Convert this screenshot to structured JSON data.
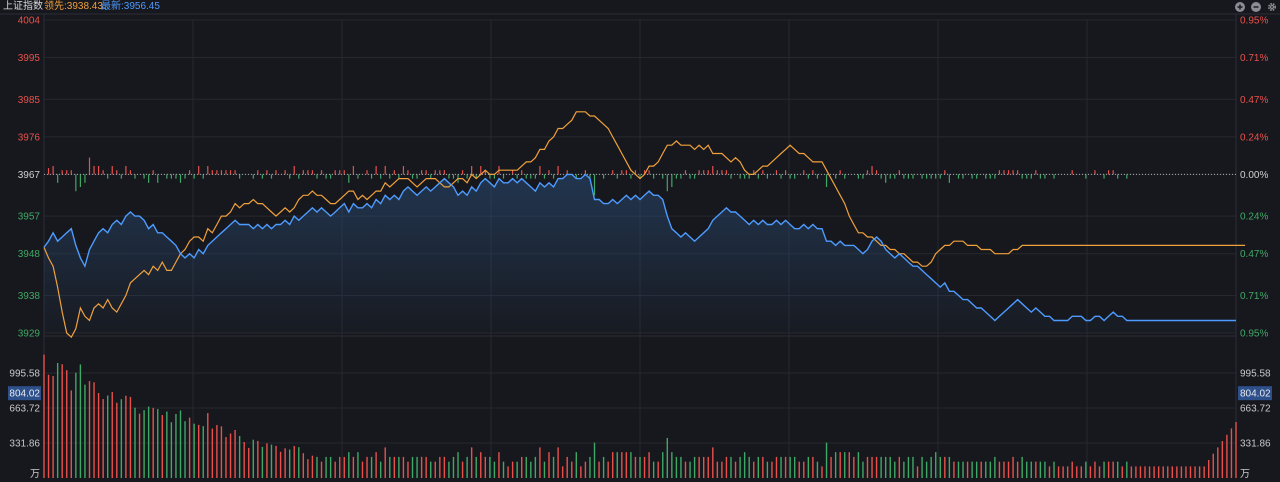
{
  "header": {
    "title": "上证指数",
    "lead_label": "领先:3938.43",
    "latest_label": "最新:3956.45",
    "icons": [
      "zoom-in-icon",
      "zoom-out-icon",
      "settings-gear-icon"
    ]
  },
  "colors": {
    "background": "#17181d",
    "up": "#e8514b",
    "down": "#3fa866",
    "flat": "#d0d0d0",
    "latest_line": "#4d9bff",
    "lead_line": "#f0a03c",
    "grid": "#262830",
    "volume_highlight": "#2d4f8a"
  },
  "chart_data": {
    "type": "line",
    "base_price": 3967,
    "price_axis": {
      "ylim": [
        3929,
        4004
      ],
      "left_ticks": [
        "4004",
        "3995",
        "3985",
        "3976",
        "3967",
        "3957",
        "3948",
        "3938",
        "3929"
      ],
      "left_tick_values": [
        4004,
        3995,
        3985,
        3976,
        3967,
        3957,
        3948,
        3938,
        3929
      ],
      "right_ticks": [
        "0.95%",
        "0.71%",
        "0.47%",
        "0.24%",
        "0.00%",
        "0.24%",
        "0.47%",
        "0.71%",
        "0.95%"
      ]
    },
    "series": [
      {
        "name": "最新",
        "color": "#4d9bff",
        "values": [
          3949.5,
          3951,
          3953,
          3951,
          3952,
          3953,
          3954,
          3950,
          3947,
          3945,
          3949,
          3951,
          3953,
          3954,
          3953,
          3955,
          3956,
          3955,
          3957,
          3958,
          3957,
          3957,
          3956,
          3954,
          3955,
          3953,
          3953,
          3952,
          3951,
          3950,
          3948,
          3947,
          3948,
          3947,
          3949,
          3948,
          3950,
          3951,
          3952,
          3953,
          3954,
          3955,
          3956,
          3955,
          3955,
          3955,
          3954,
          3955,
          3954,
          3955,
          3954,
          3955,
          3955,
          3956,
          3955,
          3957,
          3956,
          3957,
          3958,
          3959,
          3958,
          3959,
          3958,
          3957,
          3958,
          3959,
          3960,
          3958,
          3960,
          3959,
          3959,
          3960,
          3959,
          3961,
          3960,
          3962,
          3961,
          3962,
          3961,
          3963,
          3964,
          3963,
          3962,
          3963,
          3964,
          3963,
          3964,
          3965,
          3966,
          3965,
          3964,
          3962,
          3963,
          3962,
          3964,
          3963,
          3965,
          3966,
          3965,
          3964,
          3966,
          3965,
          3965,
          3966,
          3965,
          3966,
          3965,
          3964,
          3963,
          3965,
          3964,
          3965,
          3964,
          3966,
          3966,
          3967,
          3967,
          3966,
          3966,
          3967,
          3966,
          3961,
          3961,
          3960,
          3960,
          3961,
          3960,
          3961,
          3962,
          3961,
          3962,
          3961,
          3962,
          3963,
          3962,
          3962,
          3961,
          3957,
          3954,
          3953,
          3952,
          3953,
          3952,
          3951,
          3952,
          3953,
          3954,
          3956,
          3957,
          3958,
          3959,
          3958,
          3958,
          3957,
          3956,
          3955,
          3956,
          3955,
          3956,
          3955,
          3955,
          3956,
          3955,
          3956,
          3955,
          3954,
          3954,
          3955,
          3954,
          3955,
          3954,
          3954,
          3951,
          3951,
          3950,
          3951,
          3950,
          3950,
          3950,
          3949,
          3948,
          3949,
          3951,
          3952,
          3951,
          3949,
          3948,
          3947,
          3948,
          3947,
          3946,
          3945,
          3945,
          3944,
          3943,
          3942,
          3941,
          3940,
          3941,
          3939,
          3939,
          3938,
          3937,
          3937,
          3936,
          3935,
          3935,
          3934,
          3933,
          3932,
          3933,
          3934,
          3935,
          3936,
          3937,
          3936,
          3935,
          3934,
          3935,
          3934,
          3933,
          3933,
          3932,
          3932,
          3932,
          3932,
          3933,
          3933,
          3933,
          3932,
          3932,
          3933,
          3933,
          3932,
          3933,
          3934,
          3933,
          3933,
          3932,
          3932,
          3932,
          3932,
          3932,
          3932,
          3932,
          3932,
          3932,
          3932,
          3932,
          3932,
          3932,
          3932,
          3932,
          3932,
          3932,
          3932,
          3932,
          3932,
          3932,
          3932,
          3932,
          3932,
          3932
        ]
      },
      {
        "name": "领先",
        "color": "#f0a03c",
        "values": [
          3949.5,
          3947,
          3945,
          3940,
          3934,
          3929,
          3928,
          3930,
          3935,
          3933,
          3932,
          3935,
          3936,
          3935,
          3937,
          3935,
          3934,
          3936,
          3938,
          3941,
          3942,
          3943,
          3944,
          3943,
          3945,
          3944,
          3946,
          3944,
          3944,
          3946,
          3948,
          3949,
          3951,
          3952,
          3952,
          3951,
          3954,
          3953,
          3955,
          3957,
          3957,
          3958,
          3960,
          3959,
          3960,
          3960,
          3961,
          3960,
          3960,
          3959,
          3958,
          3957,
          3958,
          3959,
          3958,
          3959,
          3961,
          3962,
          3962,
          3963,
          3962,
          3962,
          3961,
          3960,
          3960,
          3961,
          3962,
          3963,
          3963,
          3961,
          3962,
          3961,
          3962,
          3963,
          3963,
          3965,
          3964,
          3965,
          3966,
          3966,
          3966,
          3965,
          3964,
          3965,
          3966,
          3966,
          3966,
          3965,
          3964,
          3964,
          3965,
          3966,
          3966,
          3965,
          3967,
          3966,
          3967,
          3968,
          3967,
          3967,
          3968,
          3968,
          3968,
          3968,
          3968,
          3969,
          3970,
          3970,
          3971,
          3973,
          3973,
          3975,
          3976,
          3978,
          3978,
          3979,
          3980,
          3982,
          3982,
          3982,
          3981,
          3981,
          3980,
          3979,
          3978,
          3976,
          3974,
          3972,
          3970,
          3968,
          3967,
          3966,
          3967,
          3969,
          3969,
          3970,
          3972,
          3974,
          3974,
          3975,
          3974,
          3974,
          3974,
          3973,
          3974,
          3973,
          3974,
          3972,
          3972,
          3972,
          3971,
          3970,
          3971,
          3970,
          3968,
          3967,
          3967,
          3968,
          3969,
          3969,
          3970,
          3971,
          3972,
          3973,
          3974,
          3973,
          3972,
          3972,
          3971,
          3970,
          3970,
          3970,
          3968,
          3966,
          3964,
          3962,
          3960,
          3957,
          3955,
          3953,
          3953,
          3952,
          3952,
          3951,
          3950,
          3950,
          3949,
          3949,
          3948,
          3948,
          3947,
          3946,
          3946,
          3945,
          3945,
          3946,
          3948,
          3949,
          3950,
          3950,
          3951,
          3951,
          3951,
          3950,
          3950,
          3950,
          3949,
          3949,
          3949,
          3948,
          3948,
          3948,
          3948,
          3949,
          3949,
          3950,
          3950,
          3950,
          3950,
          3950,
          3950,
          3950,
          3950,
          3950,
          3950,
          3950,
          3950,
          3950,
          3950,
          3950,
          3950,
          3950,
          3950,
          3950,
          3950,
          3950,
          3950,
          3950,
          3950,
          3950,
          3950,
          3950,
          3950,
          3950,
          3950,
          3950,
          3950,
          3950,
          3950,
          3950,
          3950,
          3950,
          3950,
          3950,
          3950,
          3950,
          3950,
          3950,
          3950,
          3950,
          3950,
          3950,
          3950,
          3950,
          3950
        ]
      }
    ],
    "volume_axis": {
      "ylim": [
        0,
        1327
      ],
      "ticks": [
        "995.58",
        "663.72",
        "331.86"
      ],
      "tick_values": [
        995.58,
        663.72,
        331.86
      ],
      "unit": "万",
      "highlight_label": "804.02",
      "highlight_value": 804.02
    }
  }
}
